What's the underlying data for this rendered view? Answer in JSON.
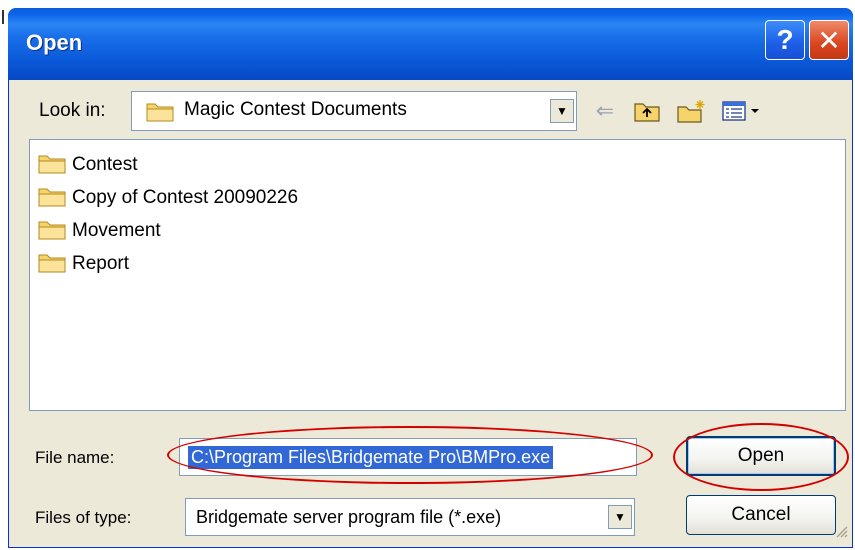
{
  "window": {
    "title": "Open",
    "help_label": "?",
    "close_label": "✕"
  },
  "lookin": {
    "label": "Look in:",
    "value": "Magic Contest Documents"
  },
  "files": [
    {
      "name": "Contest",
      "icon": "folder-icon"
    },
    {
      "name": "Copy of Contest 20090226",
      "icon": "folder-icon"
    },
    {
      "name": "Movement",
      "icon": "folder-icon"
    },
    {
      "name": "Report",
      "icon": "folder-icon"
    }
  ],
  "filename": {
    "label": "File name:",
    "value": "C:\\Program Files\\Bridgemate Pro\\BMPro.exe"
  },
  "filetype": {
    "label": "Files of type:",
    "value": "Bridgemate server program file (*.exe)"
  },
  "buttons": {
    "open_label": "Open",
    "cancel_label": "Cancel"
  },
  "colors": {
    "title_bar": "#0a58d8",
    "selection": "#3168d5",
    "annotation": "#d40000",
    "dialog_bg": "#ece9d8"
  }
}
